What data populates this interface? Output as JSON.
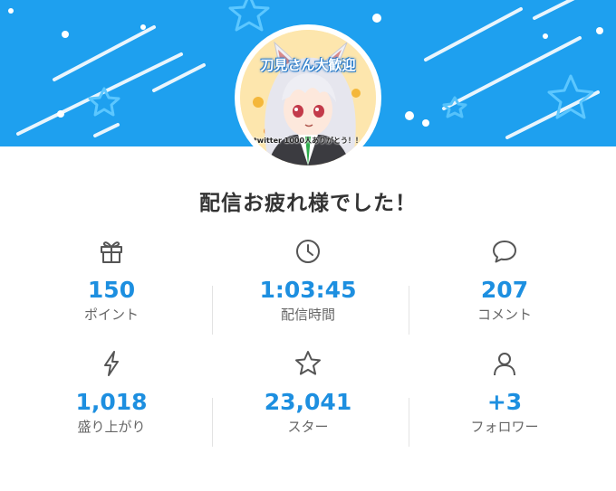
{
  "theme": {
    "banner_color": "#1ea0ef",
    "value_color": "#1d8fe0",
    "label_color": "#666666"
  },
  "avatar": {
    "caption_top": "刀見さん大歓迎",
    "caption_bottom": "twitter 1000人ありがとう！！"
  },
  "title": "配信お疲れ様でした！",
  "stats": [
    {
      "icon": "gift-icon",
      "value": "150",
      "label": "ポイント"
    },
    {
      "icon": "clock-icon",
      "value": "1:03:45",
      "label": "配信時間"
    },
    {
      "icon": "comment-icon",
      "value": "207",
      "label": "コメント"
    },
    {
      "icon": "lightning-icon",
      "value": "1,018",
      "label": "盛り上がり"
    },
    {
      "icon": "star-icon",
      "value": "23,041",
      "label": "スター"
    },
    {
      "icon": "person-icon",
      "value": "+3",
      "label": "フォロワー"
    }
  ]
}
